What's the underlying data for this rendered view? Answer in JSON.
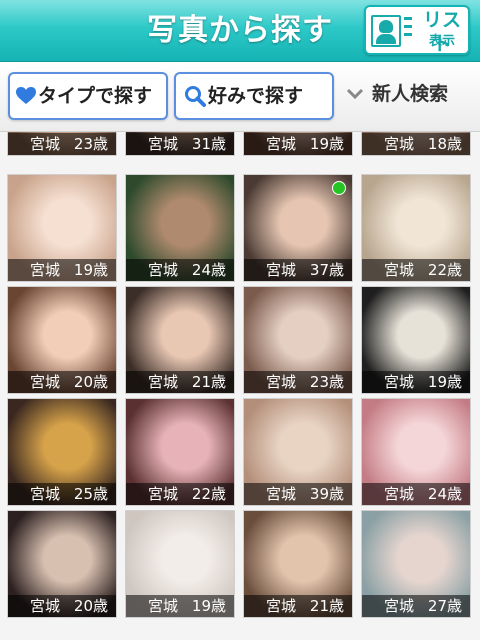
{
  "header": {
    "title": "写真から探す"
  },
  "list_button": {
    "label": "リスト",
    "sub": "表示"
  },
  "tabs": {
    "type_label": "タイプで探す",
    "pref_label": "好みで探す",
    "new_label": "新人検索"
  },
  "colors": {
    "accent": "#2dc9c8",
    "tab_border": "#5b8fe0",
    "online": "#25c425"
  },
  "icons": [
    "list-card-icon",
    "heart-icon",
    "search-icon",
    "chevron-down-icon"
  ],
  "profiles": [
    {
      "pref": "宮城",
      "age": "23歳",
      "online": false
    },
    {
      "pref": "宮城",
      "age": "31歳",
      "online": false
    },
    {
      "pref": "宮城",
      "age": "19歳",
      "online": false
    },
    {
      "pref": "宮城",
      "age": "18歳",
      "online": false
    },
    {
      "pref": "宮城",
      "age": "19歳",
      "online": false
    },
    {
      "pref": "宮城",
      "age": "24歳",
      "online": false
    },
    {
      "pref": "宮城",
      "age": "37歳",
      "online": true
    },
    {
      "pref": "宮城",
      "age": "22歳",
      "online": false
    },
    {
      "pref": "宮城",
      "age": "20歳",
      "online": false
    },
    {
      "pref": "宮城",
      "age": "21歳",
      "online": false
    },
    {
      "pref": "宮城",
      "age": "23歳",
      "online": false
    },
    {
      "pref": "宮城",
      "age": "19歳",
      "online": false
    },
    {
      "pref": "宮城",
      "age": "25歳",
      "online": false
    },
    {
      "pref": "宮城",
      "age": "22歳",
      "online": false
    },
    {
      "pref": "宮城",
      "age": "39歳",
      "online": false
    },
    {
      "pref": "宮城",
      "age": "24歳",
      "online": false
    },
    {
      "pref": "宮城",
      "age": "20歳",
      "online": false
    },
    {
      "pref": "宮城",
      "age": "19歳",
      "online": false
    },
    {
      "pref": "宮城",
      "age": "21歳",
      "online": false
    },
    {
      "pref": "宮城",
      "age": "27歳",
      "online": false
    }
  ]
}
